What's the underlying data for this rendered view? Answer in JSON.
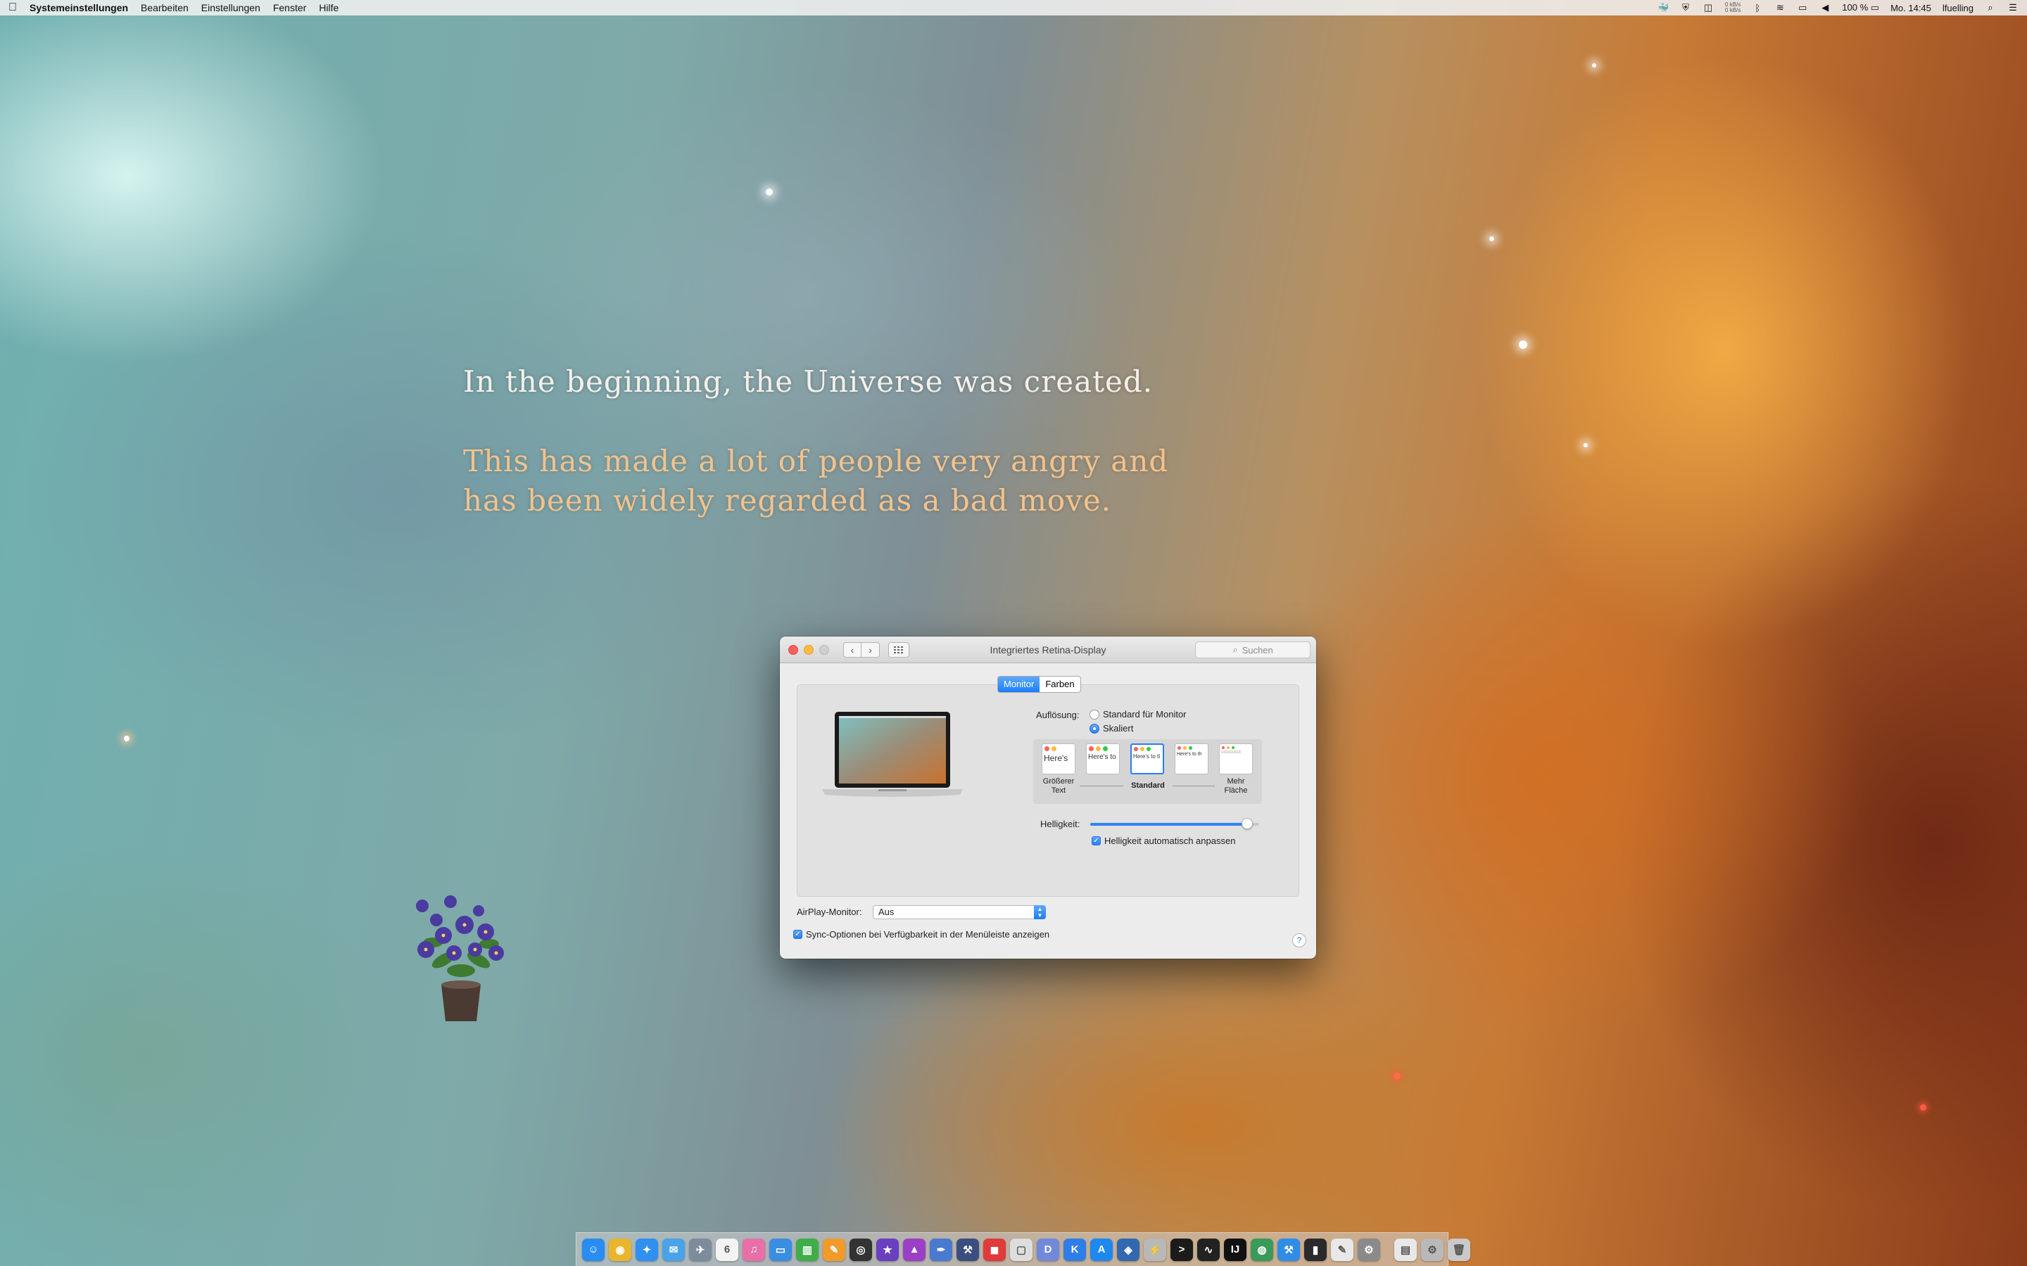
{
  "menubar": {
    "apple": "",
    "app_name": "Systemeinstellungen",
    "menus": [
      "Bearbeiten",
      "Einstellungen",
      "Fenster",
      "Hilfe"
    ],
    "net_up": "0 kB/s",
    "net_down": "0 kB/s",
    "battery": "100 %",
    "clock": "Mo. 14:45",
    "user": "lfuelling",
    "status_icons": [
      "docker-icon",
      "shield-icon",
      "vpn-icon",
      "bluetooth-icon",
      "wifi-icon",
      "airplay-icon",
      "volume-icon"
    ]
  },
  "desktop": {
    "quote_line1": "In the beginning, the Universe was created.",
    "quote_line2a": "This has made a lot of people very angry and",
    "quote_line2b": "has been widely regarded as a bad move."
  },
  "window": {
    "title": "Integriertes Retina-Display",
    "search_placeholder": "Suchen",
    "tabs": [
      "Monitor",
      "Farben"
    ],
    "resolution_label": "Auflösung:",
    "resolution_options": [
      "Standard für Monitor",
      "Skaliert"
    ],
    "resolution_selected": "Skaliert",
    "scale_preview_texts": [
      "Here's",
      "Here's to",
      "Here's to tl",
      "Here's to th",
      ""
    ],
    "scale_labels": {
      "left": "Größerer\nText",
      "middle": "Standard",
      "right": "Mehr\nFläche"
    },
    "scale_selected_index": 2,
    "brightness_label": "Helligkeit:",
    "brightness_value": 0.93,
    "auto_brightness_label": "Helligkeit automatisch anpassen",
    "auto_brightness_checked": true,
    "airplay_label": "AirPlay-Monitor:",
    "airplay_value": "Aus",
    "sync_label": "Sync-Optionen bei Verfügbarkeit in der Menüleiste anzeigen",
    "sync_checked": true,
    "help": "?"
  },
  "dock": {
    "apps": [
      {
        "name": "finder-icon",
        "color": "#2a8cf0",
        "glyph": "☺"
      },
      {
        "name": "chrome-icon",
        "color": "#e9b52d",
        "glyph": "◉"
      },
      {
        "name": "safari-icon",
        "color": "#2f90f0",
        "glyph": "✦"
      },
      {
        "name": "mail-icon",
        "color": "#4aa3e8",
        "glyph": "✉"
      },
      {
        "name": "launchpad-icon",
        "color": "#7c8c9c",
        "glyph": "✈"
      },
      {
        "name": "calendar-icon",
        "color": "#f3f3f3",
        "glyph": "6"
      },
      {
        "name": "itunes-icon",
        "color": "#e86fa8",
        "glyph": "♫"
      },
      {
        "name": "keynote-icon",
        "color": "#3a8ee0",
        "glyph": "▭"
      },
      {
        "name": "numbers-icon",
        "color": "#3fae49",
        "glyph": "▥"
      },
      {
        "name": "pages-icon",
        "color": "#f09b2a",
        "glyph": "✎"
      },
      {
        "name": "photobooth-icon",
        "color": "#333333",
        "glyph": "◎"
      },
      {
        "name": "imovie-icon",
        "color": "#6a3fc0",
        "glyph": "★"
      },
      {
        "name": "affinity-icon",
        "color": "#9b3fc6",
        "glyph": "▲"
      },
      {
        "name": "pen-icon",
        "color": "#4a7ad0",
        "glyph": "✒"
      },
      {
        "name": "toolbox-icon",
        "color": "#3c4e80",
        "glyph": "⚒"
      },
      {
        "name": "news-icon",
        "color": "#e03a3a",
        "glyph": "◼"
      },
      {
        "name": "preview-icon",
        "color": "#dddddd",
        "glyph": "▢"
      },
      {
        "name": "discord-icon",
        "color": "#7289da",
        "glyph": "D"
      },
      {
        "name": "kite-icon",
        "color": "#2f7ee8",
        "glyph": "K"
      },
      {
        "name": "appstore-icon",
        "color": "#1e88f0",
        "glyph": "A"
      },
      {
        "name": "virtualbox-icon",
        "color": "#3268b0",
        "glyph": "◈"
      },
      {
        "name": "editor-icon",
        "color": "#b8b8b8",
        "glyph": "⚡"
      },
      {
        "name": "iterm-icon",
        "color": "#1b1b1b",
        "glyph": ">"
      },
      {
        "name": "activity-monitor-icon",
        "color": "#222222",
        "glyph": "∿"
      },
      {
        "name": "intellij-icon",
        "color": "#111111",
        "glyph": "IJ"
      },
      {
        "name": "android-studio-icon",
        "color": "#3a9a58",
        "glyph": "◍"
      },
      {
        "name": "xcode-icon",
        "color": "#2f8de8",
        "glyph": "⚒"
      },
      {
        "name": "terminal-icon",
        "color": "#2a2a2a",
        "glyph": "▮"
      },
      {
        "name": "notes-icon",
        "color": "#e8e8e8",
        "glyph": "✎"
      },
      {
        "name": "system-preferences-icon",
        "color": "#8a8a8a",
        "glyph": "⚙"
      }
    ],
    "others": [
      {
        "name": "documents-icon",
        "color": "#e8e8e8",
        "glyph": "▤"
      },
      {
        "name": "downloads-icon",
        "color": "#b9b9b9",
        "glyph": "⚙"
      },
      {
        "name": "trash-icon",
        "color": "#c9c9c9",
        "glyph": "🗑"
      }
    ]
  }
}
